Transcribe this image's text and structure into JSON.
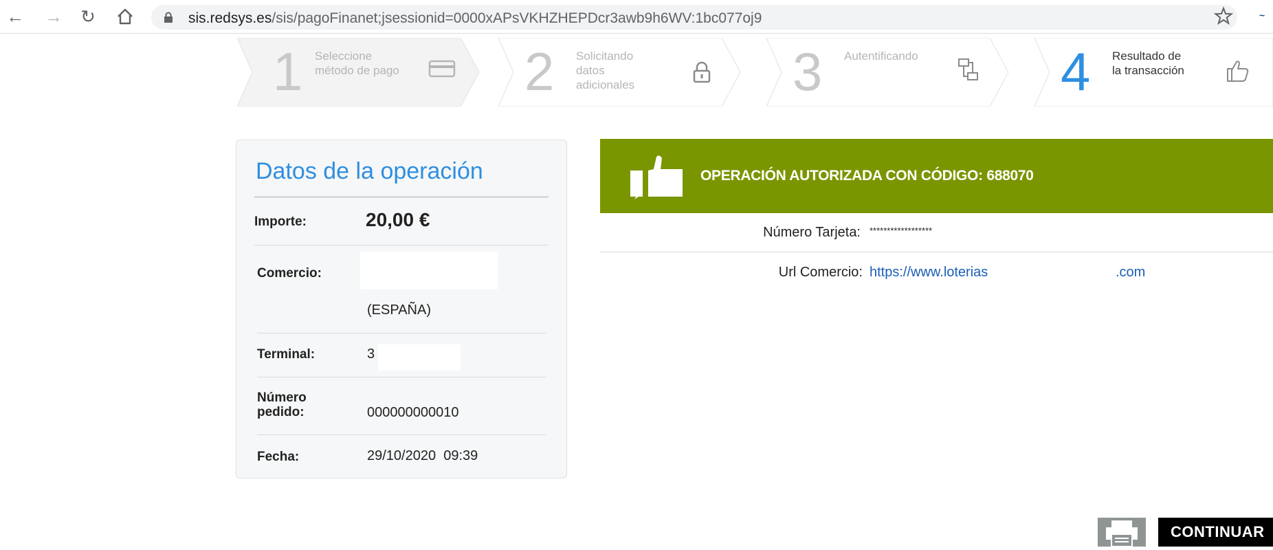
{
  "browser": {
    "url_host": "sis.redsys.es",
    "url_path": "/sis/pagoFinanet;jsessionid=0000xAPsVKHZHEPDcr3awb9h6WV:1bc077oj9"
  },
  "steps": [
    {
      "number": "1",
      "label": "Seleccione método de pago",
      "icon": "credit-card-icon",
      "active": false
    },
    {
      "number": "2",
      "label": "Solicitando datos adicionales",
      "icon": "lock-icon",
      "active": false
    },
    {
      "number": "3",
      "label": "Autentificando",
      "icon": "network-icon",
      "active": false
    },
    {
      "number": "4",
      "label": "Resultado de la transacción",
      "icon": "thumbs-up-icon",
      "active": true
    }
  ],
  "operation": {
    "title": "Datos de la operación",
    "importe_label": "Importe:",
    "importe_value": "20,00 €",
    "comercio_label": "Comercio:",
    "comercio_country": "(ESPAÑA)",
    "terminal_label": "Terminal:",
    "terminal_value": "3",
    "pedido_label": "Número pedido:",
    "pedido_value": "000000000010",
    "fecha_label": "Fecha:",
    "fecha_value": "29/10/2020  09:39"
  },
  "result": {
    "banner_text": "OPERACIÓN AUTORIZADA CON CÓDIGO:",
    "auth_code": "688070",
    "banner_color": "#799600",
    "card_label": "Número Tarjeta:",
    "card_value": "******************",
    "url_label": "Url Comercio:",
    "url_value_start": "https://www.loterias",
    "url_value_end": ".com"
  },
  "actions": {
    "continue_label": "CONTINUAR"
  },
  "colors": {
    "accent": "#2e8fe0",
    "success": "#799600",
    "link": "#1a5fb4"
  }
}
